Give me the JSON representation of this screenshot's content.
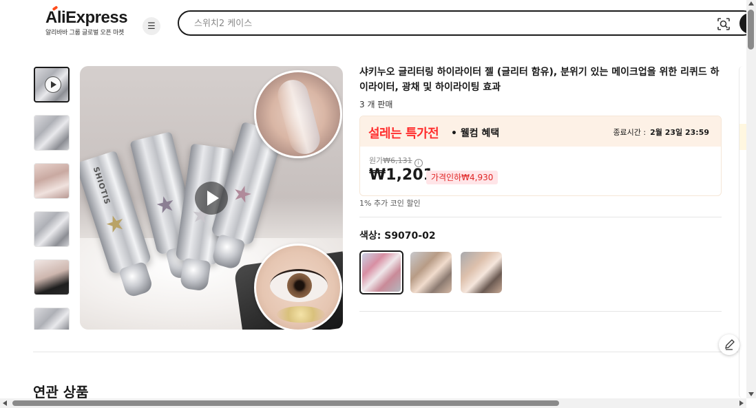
{
  "header": {
    "logo_text": "AliExpress",
    "logo_tagline": "알리바바 그룹 글로벌 오픈 마켓",
    "menu_icon": "hamburger-icon",
    "search_placeholder": "스위치2 케이스",
    "camera_icon": "image-search-icon"
  },
  "product": {
    "title": "샤키누오 글리터링 하이라이터 젤 (글리터 함유), 분위기 있는 메이크업을 위한 리퀴드 하이라이터, 광채 및 하이라이팅 효과",
    "sold": "3 개 판매",
    "deal": {
      "brand": "설레는 특가전",
      "sub": "• 웰컴 혜택",
      "end_label": "종료시간 :",
      "end_time": "2월 23일 23:59"
    },
    "original_label": "원가",
    "original_price": "₩6,131",
    "price": "₩1,201",
    "discount_badge": "가격인하₩4,930",
    "coin_text": "1% 추가 코인 할인",
    "color_label": "색상: S9070-02",
    "main_image_brand": "SHIOTIS",
    "swatches": [
      {
        "name": "S9070-02",
        "selected": true
      },
      {
        "name": "variant-2",
        "selected": false
      },
      {
        "name": "variant-3",
        "selected": false
      }
    ]
  },
  "thumbnails": [
    {
      "name": "thumb-1",
      "is_video": true,
      "active": true
    },
    {
      "name": "thumb-2"
    },
    {
      "name": "thumb-3"
    },
    {
      "name": "thumb-4"
    },
    {
      "name": "thumb-5"
    },
    {
      "name": "thumb-6"
    }
  ],
  "sections": {
    "related_title": "연관 상품"
  },
  "colors": {
    "deal_red": "#ff2d2d",
    "deal_bg": "#fdf1e6",
    "badge_bg": "#ffe5e8",
    "badge_text": "#e02525",
    "text": "#191919"
  }
}
